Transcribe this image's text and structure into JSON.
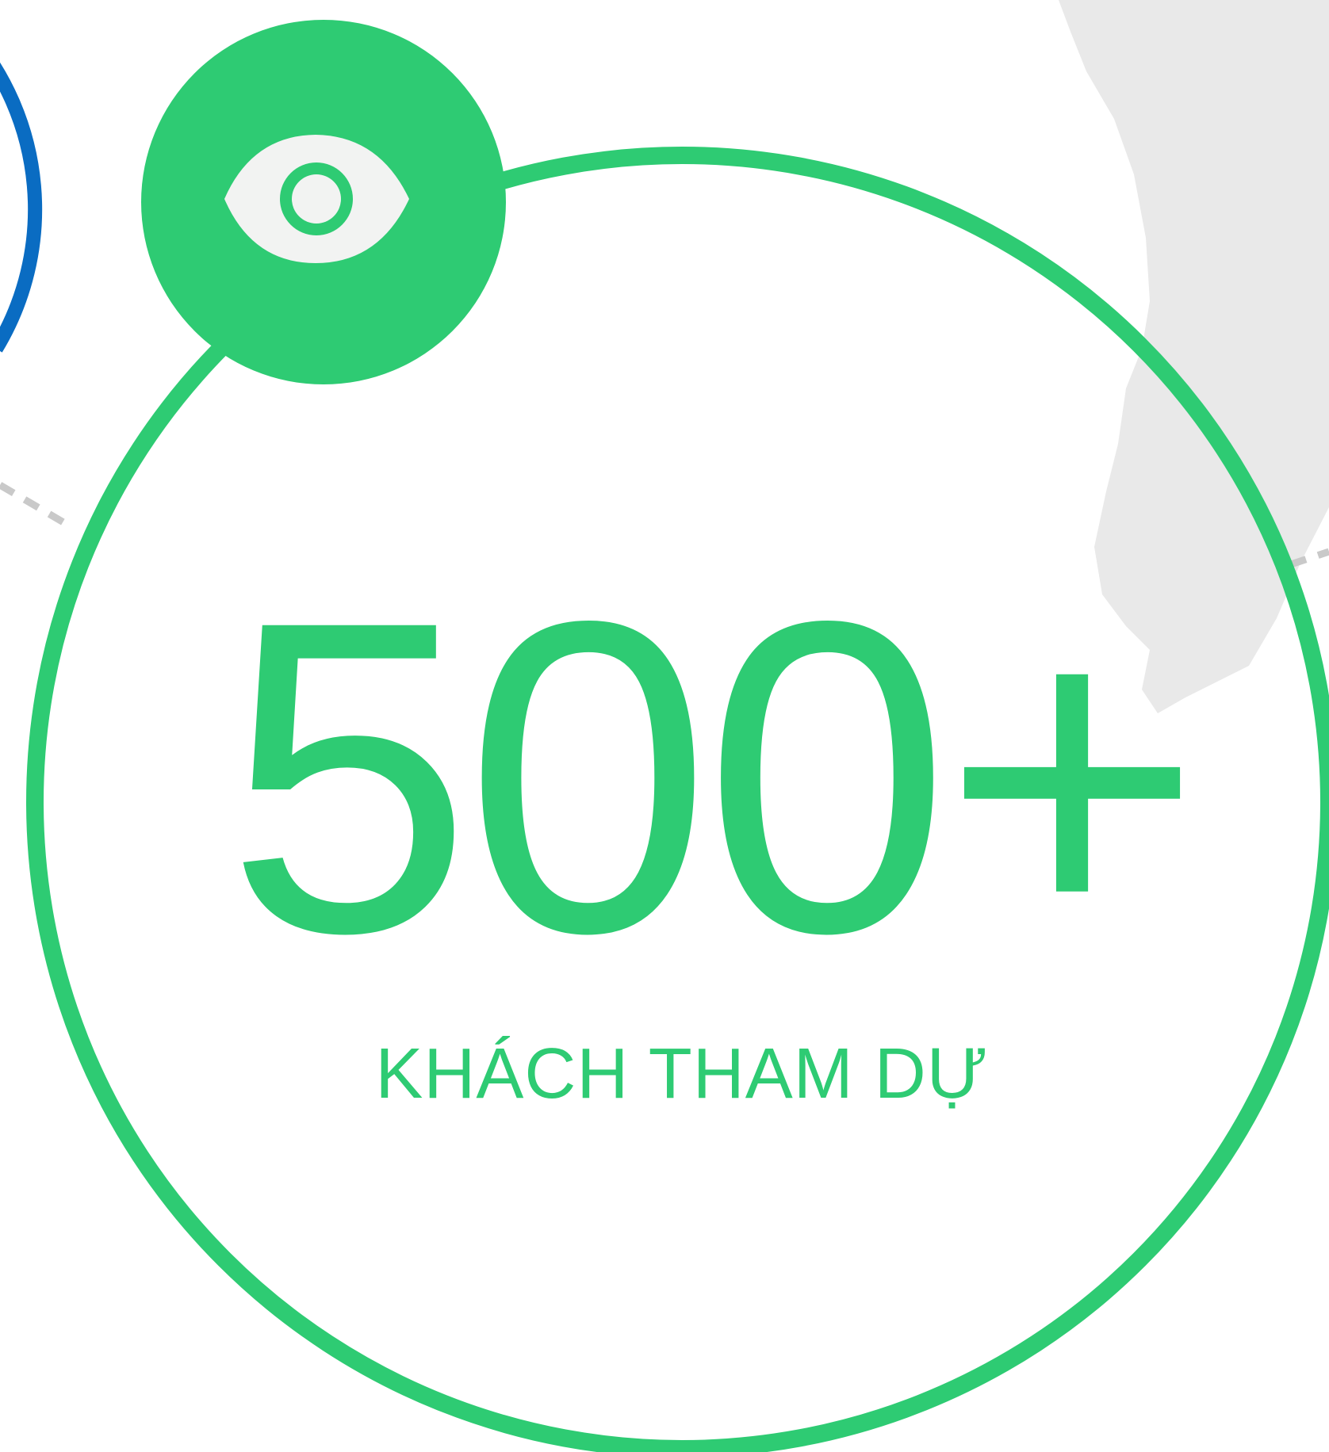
{
  "stat": {
    "value": "500+",
    "label": "KHÁCH THAM DỰ"
  },
  "badge": {
    "icon": "eye-icon"
  },
  "colors": {
    "accent": "#2ecb73",
    "neighbor_accent": "#0a6cc2",
    "map": "#e9e9e9",
    "connector": "#c9c9c9",
    "icon_fill": "#f2f3f2",
    "background": "#ffffff"
  }
}
